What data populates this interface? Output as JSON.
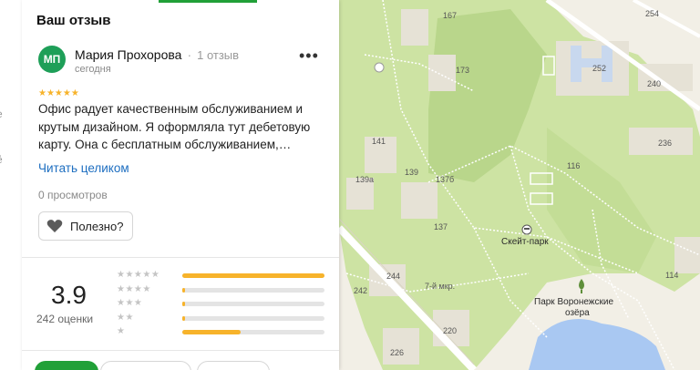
{
  "review": {
    "section_title": "Ваш отзыв",
    "avatar_initials": "МП",
    "author_name": "Мария Прохорова",
    "author_review_count": "1 отзыв",
    "date": "сегодня",
    "stars": "★★★★★",
    "text": "Офис радует качественным обслуживанием и крутым дизайном. Я оформляла тут дебетовую карту. Она с бесплатным обслуживанием,…",
    "read_more": "Читать целиком",
    "views": "0 просмотров",
    "useful_label": "Полезно?",
    "more_label": "•••"
  },
  "summary": {
    "rating": "3.9",
    "rating_count": "242 оценки",
    "distribution": [
      {
        "stars": "★★★★★",
        "fraction": 1.0
      },
      {
        "stars": "★★★★",
        "fraction": 0.02
      },
      {
        "stars": "★★★",
        "fraction": 0.02
      },
      {
        "stars": "★★",
        "fraction": 0.02
      },
      {
        "stars": "★",
        "fraction": 0.41
      }
    ]
  },
  "buttons": [
    "",
    "",
    ""
  ],
  "left_strip": [
    "е",
    "ё"
  ],
  "map": {
    "labels": {
      "n167": "167",
      "n254": "254",
      "n173": "173",
      "n252": "252",
      "n240": "240",
      "n141": "141",
      "n236": "236",
      "n139": "139",
      "n116": "116",
      "n139a": "139а",
      "n137b": "137б",
      "n137": "137",
      "n244": "244",
      "n114": "114",
      "n242": "242",
      "n220": "220",
      "n226": "226",
      "district": "7-й мкр.",
      "skatepark": "Скейт-парк",
      "park_line1": "Парк Воронежские",
      "park_line2": "озёра"
    },
    "colors": {
      "park": "#cde3a3",
      "park_dark": "#b9d68b",
      "ground": "#f2efe6",
      "building": "#e6e2d6",
      "water": "#a9c8f2"
    }
  }
}
